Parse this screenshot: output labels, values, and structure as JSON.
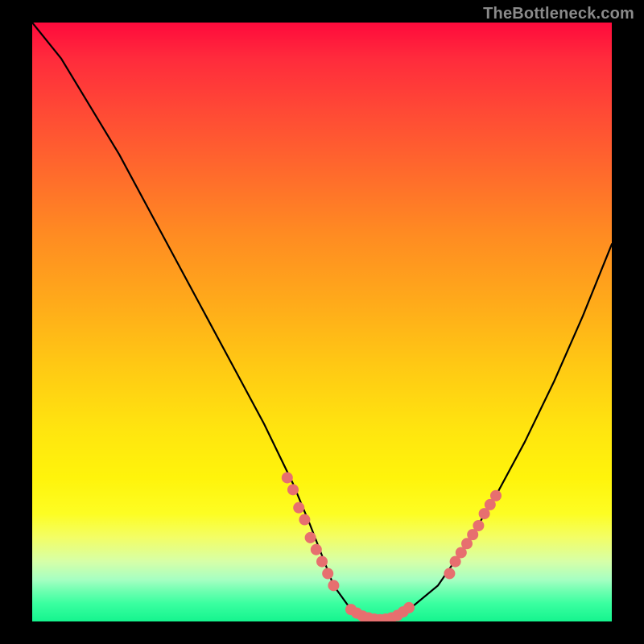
{
  "watermark": "TheBottleneck.com",
  "chart_data": {
    "type": "line",
    "title": "",
    "xlabel": "",
    "ylabel": "",
    "xlim": [
      0,
      100
    ],
    "ylim": [
      0,
      100
    ],
    "grid": false,
    "legend": false,
    "series": [
      {
        "name": "bottleneck-curve",
        "color": "#000000",
        "x": [
          0,
          5,
          10,
          15,
          20,
          25,
          30,
          35,
          40,
          45,
          48,
          50,
          52,
          55,
          58,
          60,
          62,
          65,
          70,
          75,
          80,
          85,
          90,
          95,
          100
        ],
        "y": [
          100,
          94,
          86,
          78,
          69,
          60,
          51,
          42,
          33,
          23,
          16,
          11,
          6,
          2,
          0.5,
          0,
          0.5,
          2,
          6,
          13,
          21,
          30,
          40,
          51,
          63
        ]
      }
    ],
    "markers": [
      {
        "name": "left-cluster",
        "color": "#e76f6f",
        "radius": 7,
        "points": [
          {
            "x": 44,
            "y": 24
          },
          {
            "x": 45,
            "y": 22
          },
          {
            "x": 46,
            "y": 19
          },
          {
            "x": 47,
            "y": 17
          },
          {
            "x": 48,
            "y": 14
          },
          {
            "x": 49,
            "y": 12
          },
          {
            "x": 50,
            "y": 10
          },
          {
            "x": 51,
            "y": 8
          },
          {
            "x": 52,
            "y": 6
          }
        ]
      },
      {
        "name": "bottom-cluster",
        "color": "#e76f6f",
        "radius": 7,
        "points": [
          {
            "x": 55,
            "y": 2
          },
          {
            "x": 56,
            "y": 1.4
          },
          {
            "x": 57,
            "y": 0.9
          },
          {
            "x": 58,
            "y": 0.6
          },
          {
            "x": 59,
            "y": 0.4
          },
          {
            "x": 60,
            "y": 0.3
          },
          {
            "x": 61,
            "y": 0.4
          },
          {
            "x": 62,
            "y": 0.6
          },
          {
            "x": 63,
            "y": 1
          },
          {
            "x": 64,
            "y": 1.6
          },
          {
            "x": 65,
            "y": 2.3
          }
        ]
      },
      {
        "name": "right-cluster",
        "color": "#e76f6f",
        "radius": 7,
        "points": [
          {
            "x": 72,
            "y": 8
          },
          {
            "x": 73,
            "y": 10
          },
          {
            "x": 74,
            "y": 11.5
          },
          {
            "x": 75,
            "y": 13
          },
          {
            "x": 76,
            "y": 14.5
          },
          {
            "x": 77,
            "y": 16
          },
          {
            "x": 78,
            "y": 18
          },
          {
            "x": 79,
            "y": 19.5
          },
          {
            "x": 80,
            "y": 21
          }
        ]
      }
    ],
    "background_gradient_stops": [
      {
        "pos": 0,
        "color": "#ff0a3c"
      },
      {
        "pos": 0.5,
        "color": "#ffcc14"
      },
      {
        "pos": 0.82,
        "color": "#fdfd23"
      },
      {
        "pos": 1.0,
        "color": "#15f48e"
      }
    ]
  }
}
